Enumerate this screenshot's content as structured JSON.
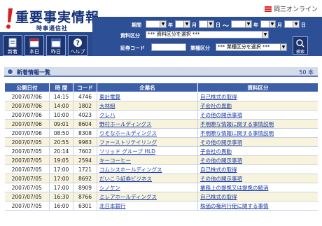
{
  "header": {
    "logo_title": "重要事実情報",
    "logo_subtitle": "時事通信社",
    "brand": "岡三オンライン"
  },
  "nav": [
    {
      "label": "新着",
      "icon": "new-doc-icon"
    },
    {
      "label": "本日",
      "icon": "calendar-icon"
    },
    {
      "label": "昨日",
      "icon": "calendar-icon"
    },
    {
      "label": "ヘルプ",
      "icon": "help-icon"
    }
  ],
  "filters": {
    "period_label": "期間",
    "year_label": "年",
    "month_label": "月",
    "day_label": "日",
    "range_sep": "〜",
    "category_label": "資料区分",
    "category_value": "*** 資料区分を選択 ***",
    "code_label": "証券コード",
    "industry_label": "業種区分",
    "industry_value": "*** 業種区分を選択 ***",
    "search_label": "検索"
  },
  "list": {
    "title": "新着情報一覧",
    "count": "50 本"
  },
  "table": {
    "headers": [
      "公開日付",
      "時 間",
      "コード",
      "企業名",
      "資料区分"
    ],
    "rows": [
      {
        "date": "2007/07/06",
        "time": "14:15",
        "code": "4746",
        "company": "東計電算",
        "category": "自己株式の取得"
      },
      {
        "date": "2007/07/06",
        "time": "14:00",
        "code": "1802",
        "company": "大林組",
        "category": "子会社の異動"
      },
      {
        "date": "2007/07/06",
        "time": "10:00",
        "code": "4023",
        "company": "クレハ",
        "category": "その他の開示事項"
      },
      {
        "date": "2007/07/06",
        "time": "09:01",
        "code": "8604",
        "company": "野村ホールディングス",
        "category": "不明瞭な情報に関する事情説明"
      },
      {
        "date": "2007/07/06",
        "time": "08:50",
        "code": "8308",
        "company": "りそなホールディングス",
        "category": "不明瞭な情報に関する事情説明"
      },
      {
        "date": "2007/07/05",
        "time": "20:55",
        "code": "9983",
        "company": "ファーストリテイリング",
        "category": "その他の開示事項"
      },
      {
        "date": "2007/07/05",
        "time": "20:14",
        "code": "7602",
        "company": "ソリッド グループ HLD",
        "category": "子会社の異動"
      },
      {
        "date": "2007/07/05",
        "time": "19:05",
        "code": "2594",
        "company": "キーコーヒー",
        "category": "その他の開示事項"
      },
      {
        "date": "2007/07/05",
        "time": "17:00",
        "code": "1721",
        "company": "コムシスホールディングス",
        "category": "自己株式の取得"
      },
      {
        "date": "2007/07/05",
        "time": "17:00",
        "code": "8692",
        "company": "だいこう証券ビジネス",
        "category": "その他の開示事項"
      },
      {
        "date": "2007/07/05",
        "time": "17:00",
        "code": "8909",
        "company": "シノケン",
        "category": "業務上の提携又は提携の解消"
      },
      {
        "date": "2007/07/05",
        "time": "16:30",
        "code": "8766",
        "company": "ミレアホールディングス",
        "category": "自己株式の取得"
      },
      {
        "date": "2007/07/05",
        "time": "16:00",
        "code": "6301",
        "company": "北日本銀行",
        "category": "株価の権利行使に関する事情"
      }
    ]
  },
  "colors": {
    "band": "#2c4f96",
    "header_text": "#14307a",
    "table_header": "#3c5fa8",
    "row_alt": "#f7f3dc",
    "link": "#1b3ca8",
    "accent_red": "#d62020"
  }
}
